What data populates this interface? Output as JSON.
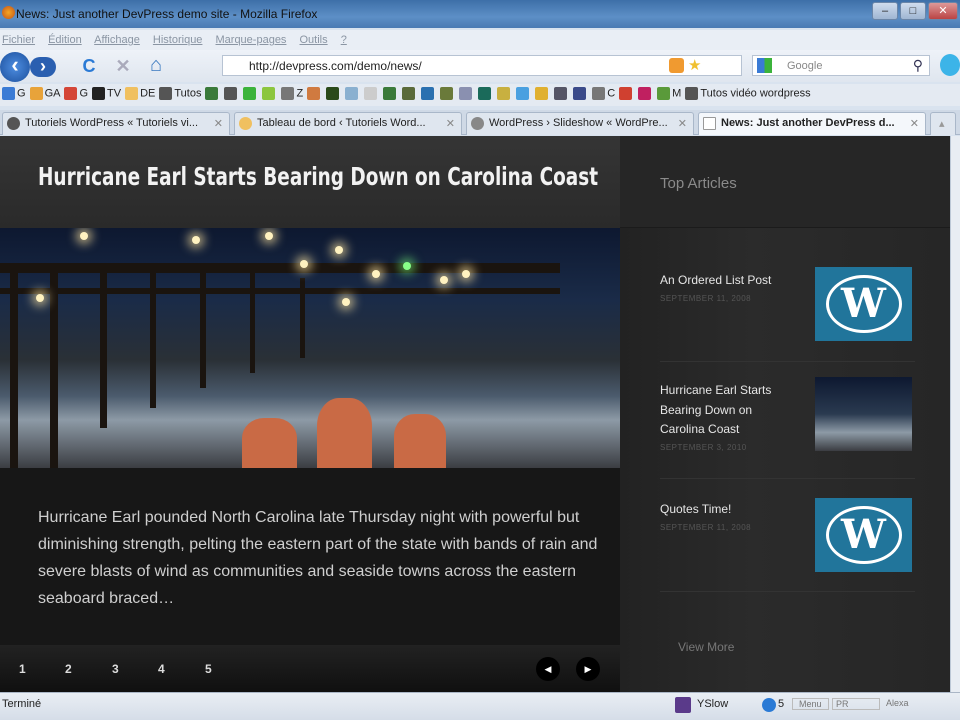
{
  "window": {
    "title": "News: Just another DevPress demo site - Mozilla Firefox",
    "minimize": "–",
    "maximize": "□",
    "close": "✕"
  },
  "menu": [
    "Fichier",
    "Édition",
    "Affichage",
    "Historique",
    "Marque-pages",
    "Outils",
    "?"
  ],
  "nav": {
    "back": "‹",
    "forward": "›",
    "reload": "C",
    "stop": "✕",
    "home": "⌂",
    "url": "http://devpress.com/demo/news/",
    "search_placeholder": "Google",
    "search_icon": "⚲"
  },
  "bookmarks": [
    {
      "label": "G",
      "color": "#3a7bd5"
    },
    {
      "label": "GA",
      "color": "#e8a33a"
    },
    {
      "label": "G",
      "color": "#d44638"
    },
    {
      "label": "TV",
      "color": "#222"
    },
    {
      "label": "DE",
      "color": "#f0c060"
    },
    {
      "label": "Tutos",
      "color": "#555"
    },
    {
      "label": "",
      "color": "#3a7a3a"
    },
    {
      "label": "",
      "color": "#555"
    },
    {
      "label": "",
      "color": "#3bb33b"
    },
    {
      "label": "",
      "color": "#8cc63f"
    },
    {
      "label": "Z",
      "color": "#777"
    },
    {
      "label": "",
      "color": "#d07a40"
    },
    {
      "label": "",
      "color": "#2a4a1a"
    },
    {
      "label": "",
      "color": "#8ab0d0"
    },
    {
      "label": "",
      "color": "#ccc"
    },
    {
      "label": "",
      "color": "#3a7a3a"
    },
    {
      "label": "",
      "color": "#5a6a3a"
    },
    {
      "label": "",
      "color": "#2a70b0"
    },
    {
      "label": "",
      "color": "#6a7a3a"
    },
    {
      "label": "",
      "color": "#8a90b0"
    },
    {
      "label": "",
      "color": "#1a6a5a"
    },
    {
      "label": "",
      "color": "#c8b040"
    },
    {
      "label": "",
      "color": "#4aa0e0"
    },
    {
      "label": "",
      "color": "#e0b030"
    },
    {
      "label": "",
      "color": "#556"
    },
    {
      "label": "",
      "color": "#3a4a8a"
    },
    {
      "label": "C",
      "color": "#777"
    },
    {
      "label": "",
      "color": "#d04030"
    },
    {
      "label": "",
      "color": "#c02060"
    },
    {
      "label": "M",
      "color": "#5a9a3a"
    },
    {
      "label": "Tutos vidéo wordpress",
      "color": "#555"
    }
  ],
  "tabs": [
    {
      "label": "Tutoriels WordPress « Tutoriels vi...",
      "active": false
    },
    {
      "label": "Tableau de bord ‹ Tutoriels Word...",
      "active": false
    },
    {
      "label": "WordPress › Slideshow « WordPre...",
      "active": false
    },
    {
      "label": "News: Just another DevPress d...",
      "active": true
    }
  ],
  "tab_close": "✕",
  "tab_scroll": "▴",
  "slider": {
    "title": "Hurricane Earl Starts Bearing Down on Carolina Coast",
    "excerpt": "Hurricane Earl pounded North Carolina late Thursday night with powerful but diminishing strength, pelting the eastern part of the state with bands of rain and severe blasts of wind as communities and seaside towns across the eastern seaboard braced…",
    "pages": [
      "1",
      "2",
      "3",
      "4",
      "5"
    ],
    "prev": "◀",
    "next": "▶"
  },
  "sidebar": {
    "title": "Top Articles",
    "articles": [
      {
        "title": "An Ordered List Post",
        "date": "SEPTEMBER 11, 2008",
        "thumb": "wordpress-logo"
      },
      {
        "title": "Hurricane Earl Starts Bearing Down on Carolina Coast",
        "date": "SEPTEMBER 3, 2010",
        "thumb": "pier-photo"
      },
      {
        "title": "Quotes Time!",
        "date": "SEPTEMBER 11, 2008",
        "thumb": "wordpress-logo"
      }
    ],
    "view_more": "View More"
  },
  "status": {
    "text": "Terminé",
    "yslow": "YSlow",
    "count": "5",
    "menu": "Menu",
    "pr": "PR",
    "alexa": "Alexa"
  },
  "colors": {
    "wp_blue": "#21759b",
    "titlebar": "#4a7ab3"
  }
}
